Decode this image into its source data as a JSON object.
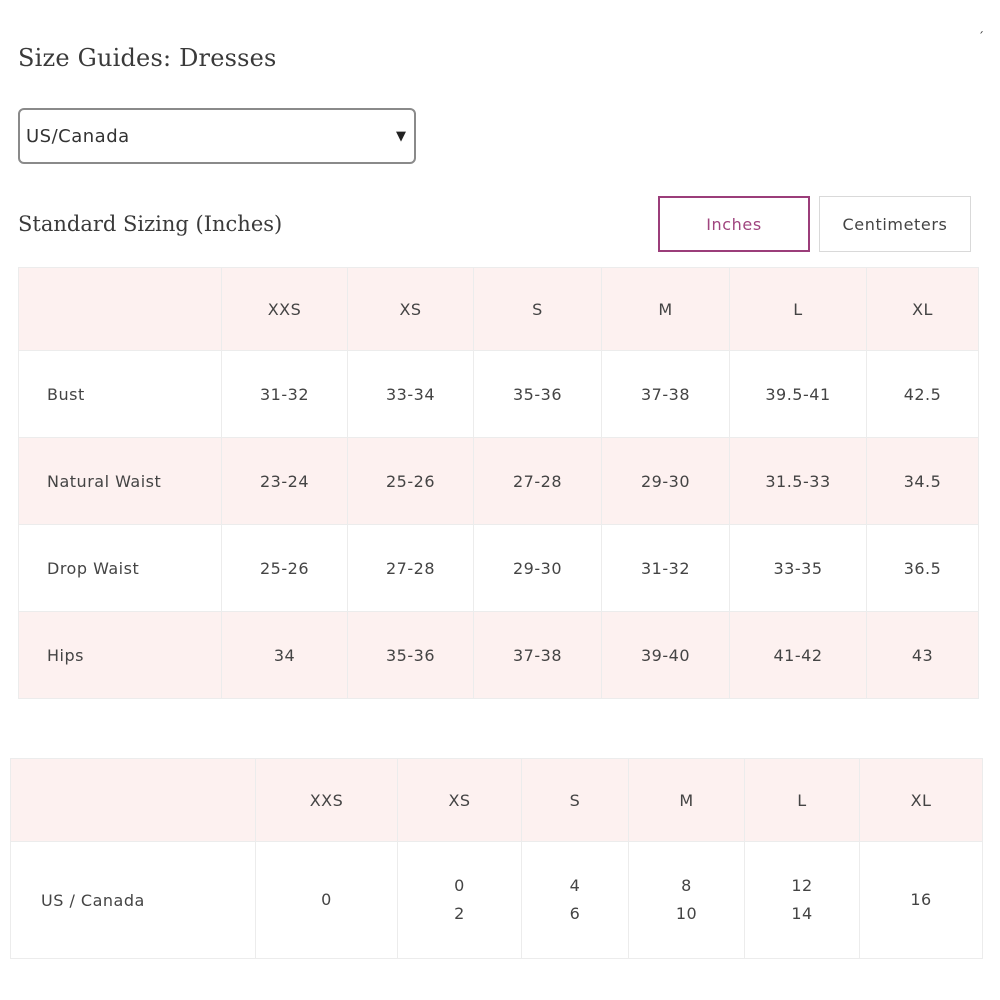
{
  "page": {
    "title": "Size Guides: Dresses",
    "corner_mark": "´"
  },
  "region_select": {
    "value": "US/Canada",
    "arrow": "▼"
  },
  "section": {
    "title": "Standard Sizing (Inches)"
  },
  "unit_toggle": {
    "inches_label": "Inches",
    "centimeters_label": "Centimeters",
    "selected": "Inches",
    "accent_color": "#9b3d7a"
  },
  "sizing_table": {
    "headers": [
      "",
      "XXS",
      "XS",
      "S",
      "M",
      "L",
      "XL"
    ],
    "rows": [
      {
        "label": "Bust",
        "values": [
          "31-32",
          "33-34",
          "35-36",
          "37-38",
          "39.5-41",
          "42.5"
        ]
      },
      {
        "label": "Natural Waist",
        "values": [
          "23-24",
          "25-26",
          "27-28",
          "29-30",
          "31.5-33",
          "34.5"
        ]
      },
      {
        "label": "Drop Waist",
        "values": [
          "25-26",
          "27-28",
          "29-30",
          "31-32",
          "33-35",
          "36.5"
        ]
      },
      {
        "label": "Hips",
        "values": [
          "34",
          "35-36",
          "37-38",
          "39-40",
          "41-42",
          "43"
        ]
      }
    ]
  },
  "conversion_table": {
    "headers": [
      "",
      "XXS",
      "XS",
      "S",
      "M",
      "L",
      "XL"
    ],
    "rows": [
      {
        "label": "US / Canada",
        "values": [
          [
            "0"
          ],
          [
            "0",
            "2"
          ],
          [
            "4",
            "6"
          ],
          [
            "8",
            "10"
          ],
          [
            "12",
            "14"
          ],
          [
            "16"
          ]
        ]
      }
    ]
  },
  "colors": {
    "pink_row": "#fdf1f0",
    "border": "#ececec"
  }
}
